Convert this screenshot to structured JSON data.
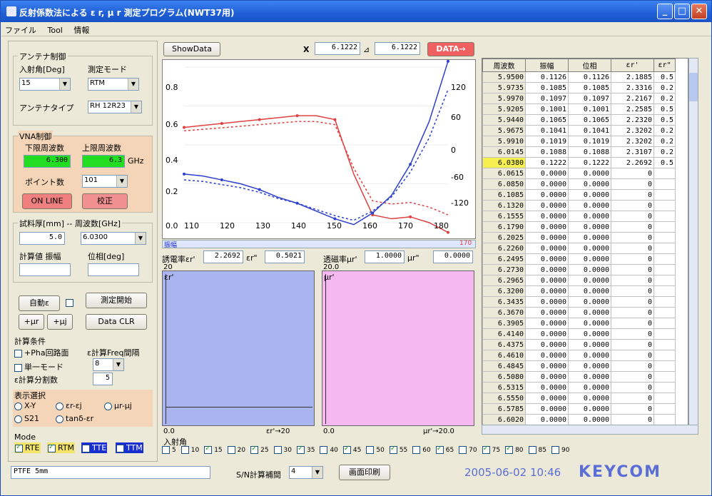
{
  "window": {
    "title": "反射係数法による ε r, μ r 測定プログラム(NWT37用)",
    "min": "_",
    "max": "□",
    "close": "✕"
  },
  "menu": [
    "ファイル",
    "Tool",
    "情報"
  ],
  "antenna": {
    "legend": "アンテナ制御",
    "angle_label": "入射角[Deg]",
    "angle_value": "15",
    "mode_label": "測定モード",
    "mode_value": "RTM",
    "type_label": "アンテナタイプ",
    "type_value": "RH 12R23"
  },
  "vna": {
    "legend": "VNA制御",
    "low_label": "下限周波数",
    "high_label": "上限周波数",
    "low_value": "6.300",
    "high_value": "6.3",
    "unit": "GHz",
    "points_label": "ポイント数",
    "points_value": "101",
    "online_button": "ON LINE",
    "calib_button": "校正"
  },
  "sample": {
    "legend": "試料厚[mm] -- 周波数[GHz]",
    "thickness": "5.0",
    "freq": "6.0300",
    "calc_label": "計算値 振幅",
    "phase_label": "位相[deg]"
  },
  "controls": {
    "auto_button": "自動ε",
    "start_button": "測定開始",
    "ur_button": "+μr",
    "uj_button": "+μj",
    "clr_button": "Data CLR"
  },
  "calc_cond": {
    "legend": "計算条件",
    "opt1": "+Pha回路面",
    "opt2": "ε計算Freq間隔",
    "opt2_value": "8",
    "opt3": "単一モード",
    "opt4": "ε計算分割数",
    "opt4_value": "5"
  },
  "display": {
    "legend": "表示選択",
    "r1": "X-Y",
    "r2": "εr-εj",
    "r3": "μr-μj",
    "r4": "S21",
    "r5": "tanδ-εr"
  },
  "mode": {
    "legend": "Mode",
    "rte": "RTE",
    "rtm": "RTM",
    "tte": "TTE",
    "ttm": "TTM"
  },
  "status_input": "PTFE 5mm",
  "interp": {
    "label": "S/N計算補間",
    "value": "4",
    "print_button": "画面印刷"
  },
  "timestamp": "2005-06-02 10:46",
  "brand": "KEYCOM",
  "plot": {
    "showdata_button": "ShowData",
    "x_label": "X",
    "x_value": "6.1222",
    "x2_value": "6.1222",
    "data_button": "DATA→",
    "yaxis_left": [
      "0.8",
      "0.6",
      "0.4",
      "0.2",
      "0.0"
    ],
    "yaxis_right": [
      "120",
      "60",
      "0",
      "-60",
      "-120"
    ],
    "xaxis": [
      "110",
      "120",
      "130",
      "140",
      "150",
      "160",
      "170",
      "180"
    ],
    "corner_label": "振幅",
    "corner_right": "170"
  },
  "chart_data": {
    "type": "line",
    "x": [
      110,
      115,
      120,
      125,
      130,
      135,
      140,
      145,
      150,
      155,
      160,
      165,
      170,
      175,
      180
    ],
    "series": [
      {
        "name": "amplitude_solid",
        "color": "#e04040",
        "values": [
          0.49,
          0.5,
          0.51,
          0.52,
          0.53,
          0.54,
          0.55,
          0.55,
          0.53,
          0.25,
          0.04,
          0.02,
          0.03,
          0.0,
          -0.05
        ]
      },
      {
        "name": "phase_solid",
        "color": "#2b3fd0",
        "values": [
          0.25,
          0.24,
          0.22,
          0.2,
          0.17,
          0.13,
          0.1,
          0.06,
          0.02,
          -0.01,
          0.05,
          0.14,
          0.3,
          0.52,
          0.83
        ]
      }
    ],
    "ylim": [
      0.0,
      0.8
    ]
  },
  "er_readout": {
    "label1": "誘電率εr'",
    "value1": "2.2692",
    "label2": "εr\"",
    "value2": "0.5021",
    "label3": "透磁率μr'",
    "value3": "1.0000",
    "label4": "μr\"",
    "value4": "0.0000"
  },
  "left_plot": {
    "top": "20",
    "title": "εr'",
    "bottom_left": "0.0",
    "bottom_right": "εr'→20"
  },
  "right_plot": {
    "top": "20.0",
    "title": "μr'",
    "bottom_left": "0.0",
    "bottom_right": "μr'→20.0"
  },
  "angle_row": {
    "label": "入射角",
    "values": [
      "5",
      "10",
      "15",
      "20",
      "25",
      "30",
      "35",
      "40",
      "45",
      "50",
      "55",
      "60",
      "65",
      "70",
      "75",
      "80",
      "85",
      "90"
    ],
    "checked": [
      "15",
      "25",
      "35",
      "45",
      "55",
      "65",
      "75",
      "80"
    ]
  },
  "table": {
    "headers": [
      "周波数",
      "振幅",
      "位相",
      "εr'",
      "εr\""
    ],
    "rows": [
      [
        "5.9500",
        "0.1126",
        "0.1126",
        "2.1885",
        "0.5"
      ],
      [
        "5.9735",
        "0.1085",
        "0.1085",
        "2.3316",
        "0.2"
      ],
      [
        "5.9970",
        "0.1097",
        "0.1097",
        "2.2167",
        "0.2"
      ],
      [
        "5.9205",
        "0.1001",
        "0.1001",
        "2.2585",
        "0.5"
      ],
      [
        "5.9440",
        "0.1065",
        "0.1065",
        "2.2320",
        "0.5"
      ],
      [
        "5.9675",
        "0.1041",
        "0.1041",
        "2.3202",
        "0.2"
      ],
      [
        "5.9910",
        "0.1019",
        "0.1019",
        "2.3202",
        "0.2"
      ],
      [
        "6.0145",
        "0.1088",
        "0.1088",
        "2.3107",
        "0.2"
      ],
      [
        "6.0380",
        "0.1222",
        "0.1222",
        "2.2692",
        "0.5"
      ],
      [
        "6.0615",
        "0.0000",
        "0.0000",
        "0",
        ""
      ],
      [
        "6.0850",
        "0.0000",
        "0.0000",
        "0",
        ""
      ],
      [
        "6.1085",
        "0.0000",
        "0.0000",
        "0",
        ""
      ],
      [
        "6.1320",
        "0.0000",
        "0.0000",
        "0",
        ""
      ],
      [
        "6.1555",
        "0.0000",
        "0.0000",
        "0",
        ""
      ],
      [
        "6.1790",
        "0.0000",
        "0.0000",
        "0",
        ""
      ],
      [
        "6.2025",
        "0.0000",
        "0.0000",
        "0",
        ""
      ],
      [
        "6.2260",
        "0.0000",
        "0.0000",
        "0",
        ""
      ],
      [
        "6.2495",
        "0.0000",
        "0.0000",
        "0",
        ""
      ],
      [
        "6.2730",
        "0.0000",
        "0.0000",
        "0",
        ""
      ],
      [
        "6.2965",
        "0.0000",
        "0.0000",
        "0",
        ""
      ],
      [
        "6.3200",
        "0.0000",
        "0.0000",
        "0",
        ""
      ],
      [
        "6.3435",
        "0.0000",
        "0.0000",
        "0",
        ""
      ],
      [
        "6.3670",
        "0.0000",
        "0.0000",
        "0",
        ""
      ],
      [
        "6.3905",
        "0.0000",
        "0.0000",
        "0",
        ""
      ],
      [
        "6.4140",
        "0.0000",
        "0.0000",
        "0",
        ""
      ],
      [
        "6.4375",
        "0.0000",
        "0.0000",
        "0",
        ""
      ],
      [
        "6.4610",
        "0.0000",
        "0.0000",
        "0",
        ""
      ],
      [
        "6.4845",
        "0.0000",
        "0.0000",
        "0",
        ""
      ],
      [
        "6.5080",
        "0.0000",
        "0.0000",
        "0",
        ""
      ],
      [
        "6.5315",
        "0.0000",
        "0.0000",
        "0",
        ""
      ],
      [
        "6.5550",
        "0.0000",
        "0.0000",
        "0",
        ""
      ],
      [
        "6.5785",
        "0.0000",
        "0.0000",
        "0",
        ""
      ],
      [
        "6.6020",
        "0.0000",
        "0.0000",
        "0",
        ""
      ]
    ],
    "highlight_row": 8
  }
}
